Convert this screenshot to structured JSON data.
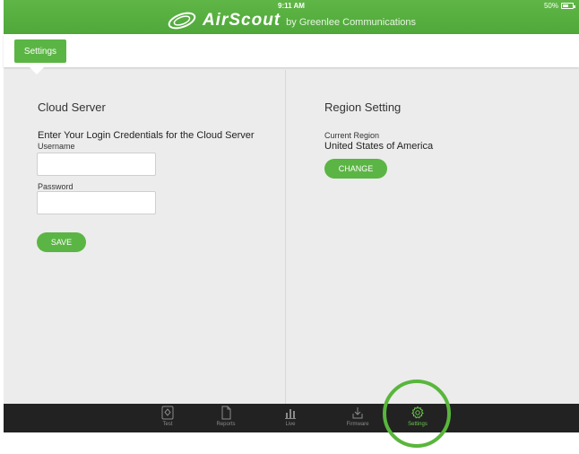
{
  "status": {
    "time": "9:11 AM",
    "battery": "50%"
  },
  "brand": {
    "name": "AirScout",
    "subtitle": "by Greenlee Communications"
  },
  "top_tab": {
    "label": "Settings"
  },
  "cloud": {
    "title": "Cloud Server",
    "prompt": "Enter Your Login Credentials for the Cloud Server",
    "username_label": "Username",
    "username_value": "",
    "password_label": "Password",
    "password_value": "",
    "save_label": "SAVE"
  },
  "region": {
    "title": "Region Setting",
    "current_label": "Current Region",
    "current_value": "United States of America",
    "change_label": "CHANGE"
  },
  "bottom_nav": [
    {
      "label": "Test",
      "icon": "test-icon"
    },
    {
      "label": "Reports",
      "icon": "document-icon"
    },
    {
      "label": "Live",
      "icon": "bar-chart-icon"
    },
    {
      "label": "Firmware",
      "icon": "download-icon"
    },
    {
      "label": "Settings",
      "icon": "gear-icon",
      "active": true
    }
  ],
  "colors": {
    "accent": "#5bb544",
    "header": "#55ad3e",
    "bottom_bar": "#222222",
    "highlight": "#59b63c"
  }
}
